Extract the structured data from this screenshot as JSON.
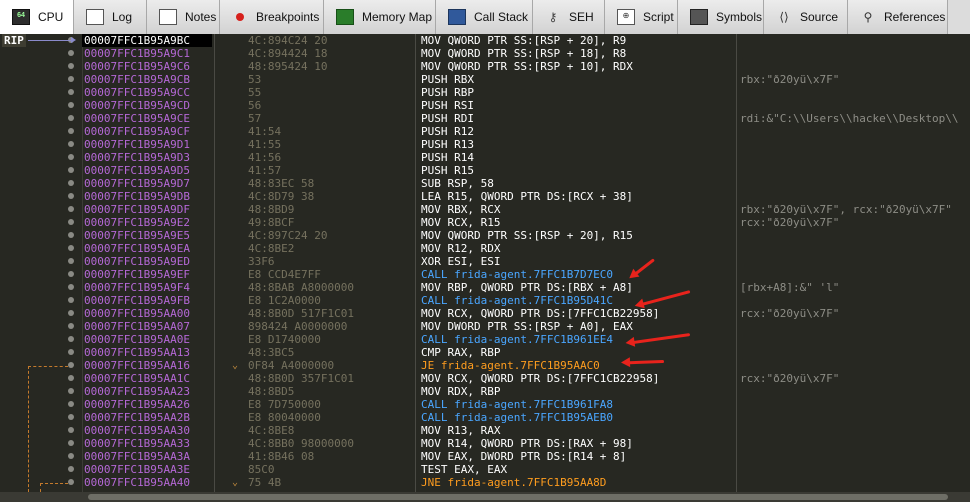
{
  "tabs": [
    {
      "label": "CPU",
      "icon": "cpu-icon",
      "glyph": "64",
      "active": true
    },
    {
      "label": "Log",
      "icon": "log-icon",
      "glyph": "",
      "active": false
    },
    {
      "label": "Notes",
      "icon": "notes-icon",
      "glyph": "",
      "active": false
    },
    {
      "label": "Breakpoints",
      "icon": "breakpoint-icon",
      "glyph": "",
      "active": false
    },
    {
      "label": "Memory Map",
      "icon": "memory-map-icon",
      "glyph": "",
      "active": false
    },
    {
      "label": "Call Stack",
      "icon": "call-stack-icon",
      "glyph": "",
      "active": false
    },
    {
      "label": "SEH",
      "icon": "seh-icon",
      "glyph": "⚷",
      "active": false
    },
    {
      "label": "Script",
      "icon": "script-icon",
      "glyph": "⊕",
      "active": false
    },
    {
      "label": "Symbols",
      "icon": "symbols-icon",
      "glyph": "",
      "active": false
    },
    {
      "label": "Source",
      "icon": "source-icon",
      "glyph": "⟨⟩",
      "active": false
    },
    {
      "label": "References",
      "icon": "references-icon",
      "glyph": "⚲",
      "active": false
    }
  ],
  "rip_label": "RIP",
  "rows": [
    {
      "addr": "00007FFC1B95A9BC",
      "bytes": "4C:894C24 20",
      "instr": "MOV QWORD PTR SS:[RSP + 20], R9",
      "kind": "",
      "comment": "",
      "current": true
    },
    {
      "addr": "00007FFC1B95A9C1",
      "bytes": "4C:894424 18",
      "instr": "MOV QWORD PTR SS:[RSP + 18], R8",
      "kind": "",
      "comment": ""
    },
    {
      "addr": "00007FFC1B95A9C6",
      "bytes": "48:895424 10",
      "instr": "MOV QWORD PTR SS:[RSP + 10], RDX",
      "kind": "",
      "comment": ""
    },
    {
      "addr": "00007FFC1B95A9CB",
      "bytes": "53",
      "instr": "PUSH RBX",
      "kind": "",
      "comment": "rbx:\"ð20yü\\x7F\""
    },
    {
      "addr": "00007FFC1B95A9CC",
      "bytes": "55",
      "instr": "PUSH RBP",
      "kind": "",
      "comment": ""
    },
    {
      "addr": "00007FFC1B95A9CD",
      "bytes": "56",
      "instr": "PUSH RSI",
      "kind": "",
      "comment": ""
    },
    {
      "addr": "00007FFC1B95A9CE",
      "bytes": "57",
      "instr": "PUSH RDI",
      "kind": "",
      "comment": "rdi:&\"C:\\\\Users\\\\hacke\\\\Desktop\\\\"
    },
    {
      "addr": "00007FFC1B95A9CF",
      "bytes": "41:54",
      "instr": "PUSH R12",
      "kind": "",
      "comment": ""
    },
    {
      "addr": "00007FFC1B95A9D1",
      "bytes": "41:55",
      "instr": "PUSH R13",
      "kind": "",
      "comment": ""
    },
    {
      "addr": "00007FFC1B95A9D3",
      "bytes": "41:56",
      "instr": "PUSH R14",
      "kind": "",
      "comment": ""
    },
    {
      "addr": "00007FFC1B95A9D5",
      "bytes": "41:57",
      "instr": "PUSH R15",
      "kind": "",
      "comment": ""
    },
    {
      "addr": "00007FFC1B95A9D7",
      "bytes": "48:83EC 58",
      "instr": "SUB RSP, 58",
      "kind": "",
      "comment": ""
    },
    {
      "addr": "00007FFC1B95A9DB",
      "bytes": "4C:8D79 38",
      "instr": "LEA R15, QWORD PTR DS:[RCX + 38]",
      "kind": "",
      "comment": ""
    },
    {
      "addr": "00007FFC1B95A9DF",
      "bytes": "48:8BD9",
      "instr": "MOV RBX, RCX",
      "kind": "",
      "comment": "rbx:\"ð20yü\\x7F\", rcx:\"ð20yü\\x7F\""
    },
    {
      "addr": "00007FFC1B95A9E2",
      "bytes": "49:8BCF",
      "instr": "MOV RCX, R15",
      "kind": "",
      "comment": "rcx:\"ð20yü\\x7F\""
    },
    {
      "addr": "00007FFC1B95A9E5",
      "bytes": "4C:897C24 20",
      "instr": "MOV QWORD PTR SS:[RSP + 20], R15",
      "kind": "",
      "comment": ""
    },
    {
      "addr": "00007FFC1B95A9EA",
      "bytes": "4C:8BE2",
      "instr": "MOV R12, RDX",
      "kind": "",
      "comment": ""
    },
    {
      "addr": "00007FFC1B95A9ED",
      "bytes": "33F6",
      "instr": "XOR ESI, ESI",
      "kind": "",
      "comment": ""
    },
    {
      "addr": "00007FFC1B95A9EF",
      "bytes": "E8 CCD4E7FF",
      "instr": "CALL frida-agent.7FFC1B7D7EC0",
      "kind": "call",
      "comment": ""
    },
    {
      "addr": "00007FFC1B95A9F4",
      "bytes": "48:8BAB A8000000",
      "instr": "MOV RBP, QWORD PTR DS:[RBX + A8]",
      "kind": "",
      "comment": "[rbx+A8]:&\" 'l\""
    },
    {
      "addr": "00007FFC1B95A9FB",
      "bytes": "E8 1C2A0000",
      "instr": "CALL frida-agent.7FFC1B95D41C",
      "kind": "call",
      "comment": ""
    },
    {
      "addr": "00007FFC1B95AA00",
      "bytes": "48:8B0D 517F1C01",
      "instr": "MOV RCX, QWORD PTR DS:[7FFC1CB22958]",
      "kind": "",
      "comment": "rcx:\"ð20yü\\x7F\""
    },
    {
      "addr": "00007FFC1B95AA07",
      "bytes": "898424 A0000000",
      "instr": "MOV DWORD PTR SS:[RSP + A0], EAX",
      "kind": "",
      "comment": ""
    },
    {
      "addr": "00007FFC1B95AA0E",
      "bytes": "E8 D1740000",
      "instr": "CALL frida-agent.7FFC1B961EE4",
      "kind": "call",
      "comment": ""
    },
    {
      "addr": "00007FFC1B95AA13",
      "bytes": "48:3BC5",
      "instr": "CMP RAX, RBP",
      "kind": "",
      "comment": ""
    },
    {
      "addr": "00007FFC1B95AA16",
      "bytes": "0F84 A4000000",
      "instr": "JE frida-agent.7FFC1B95AAC0",
      "kind": "jmp",
      "comment": "",
      "jmark": "⌄"
    },
    {
      "addr": "00007FFC1B95AA1C",
      "bytes": "48:8B0D 357F1C01",
      "instr": "MOV RCX, QWORD PTR DS:[7FFC1CB22958]",
      "kind": "",
      "comment": "rcx:\"ð20yü\\x7F\""
    },
    {
      "addr": "00007FFC1B95AA23",
      "bytes": "48:8BD5",
      "instr": "MOV RDX, RBP",
      "kind": "",
      "comment": ""
    },
    {
      "addr": "00007FFC1B95AA26",
      "bytes": "E8 7D750000",
      "instr": "CALL frida-agent.7FFC1B961FA8",
      "kind": "call",
      "comment": ""
    },
    {
      "addr": "00007FFC1B95AA2B",
      "bytes": "E8 80040000",
      "instr": "CALL frida-agent.7FFC1B95AEB0",
      "kind": "call",
      "comment": ""
    },
    {
      "addr": "00007FFC1B95AA30",
      "bytes": "4C:8BE8",
      "instr": "MOV R13, RAX",
      "kind": "",
      "comment": ""
    },
    {
      "addr": "00007FFC1B95AA33",
      "bytes": "4C:8BB0 98000000",
      "instr": "MOV R14, QWORD PTR DS:[RAX + 98]",
      "kind": "",
      "comment": ""
    },
    {
      "addr": "00007FFC1B95AA3A",
      "bytes": "41:8B46 08",
      "instr": "MOV EAX, DWORD PTR DS:[R14 + 8]",
      "kind": "",
      "comment": ""
    },
    {
      "addr": "00007FFC1B95AA3E",
      "bytes": "85C0",
      "instr": "TEST EAX, EAX",
      "kind": "",
      "comment": ""
    },
    {
      "addr": "00007FFC1B95AA40",
      "bytes": "75 4B",
      "instr": "JNE frida-agent.7FFC1B95AA8D",
      "kind": "jmp",
      "comment": "",
      "jmark": "⌄"
    }
  ]
}
